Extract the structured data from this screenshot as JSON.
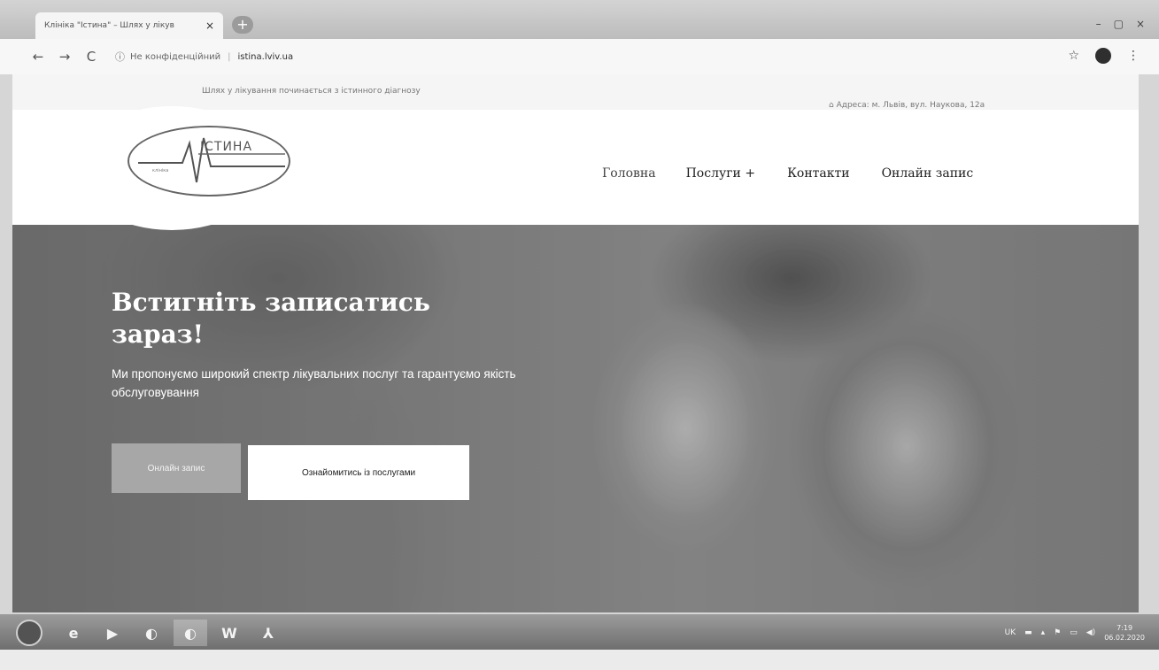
{
  "browser": {
    "tab_title": "Клініка \"Істина\" – Шлях у лікув",
    "tab_close": "×",
    "new_tab": "+",
    "back": "←",
    "forward": "→",
    "reload": "C",
    "security_icon": "ⓘ",
    "security_label": "Не конфіденційний",
    "url": "istina.lviv.ua",
    "bookmark_icon": "☆",
    "menu_icon": "⋮",
    "window_controls": [
      "–",
      "▢",
      "×"
    ]
  },
  "topbar": {
    "slogan": "Шлях у лікування починається з істинного діагнозу",
    "address": "Адреса: м. Львів, вул. Наукова, 12а"
  },
  "logo": {
    "name": "ІСТИНА",
    "sub": "клініка"
  },
  "nav": {
    "items": [
      {
        "label": "Головна"
      },
      {
        "label": "Послуги +"
      },
      {
        "label": "Контакти"
      },
      {
        "label": "Онлайн запис"
      }
    ]
  },
  "hero": {
    "title": "Встигніть записатись зараз!",
    "text": "Ми пропонуємо широкий спектр лікувальних послуг та гарантуємо якість обслуговування",
    "primary_button": "Онлайн запис",
    "secondary_button": "Ознайомитись із послугами"
  },
  "taskbar": {
    "icons": [
      {
        "name": "internet-explorer",
        "glyph": "e"
      },
      {
        "name": "media-player",
        "glyph": "▶"
      },
      {
        "name": "chrome",
        "glyph": "◐"
      },
      {
        "name": "chrome-active",
        "glyph": "◐"
      },
      {
        "name": "word",
        "glyph": "W"
      },
      {
        "name": "acrobat",
        "glyph": "⅄"
      }
    ],
    "language": "UK",
    "time": "7:19",
    "date": "06.02.2020"
  }
}
